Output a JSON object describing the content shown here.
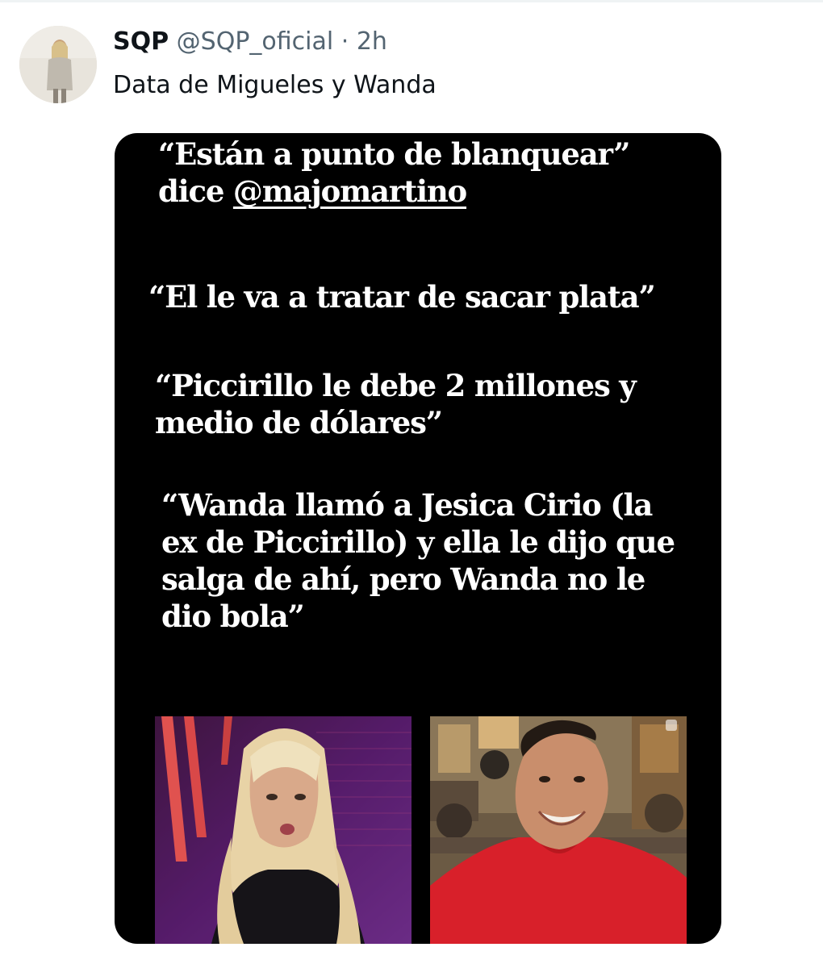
{
  "tweet": {
    "author_name": "SQP",
    "handle": "@SQP_oficial",
    "separator": "·",
    "time": "2h",
    "text": "Data de Migueles y Wanda"
  },
  "media": {
    "quote1_prefix": "“Están a punto de blanquear”",
    "quote1_dice": "dice ",
    "quote1_mention": "@majomartino",
    "quote2": "“El le va a tratar de sacar plata”",
    "quote3_lines": [
      "“Piccirillo le debe 2 millones y",
      "medio de dólares”"
    ],
    "quote4_lines": [
      "“Wanda llamó a Jesica Cirio (la",
      "ex de Piccirillo) y ella le dijo que",
      "salga de ahí, pero Wanda no le",
      "dio bola”"
    ]
  },
  "icons": {
    "avatar": "profile-photo",
    "left_photo": "woman-blonde-tv-studio-photo",
    "right_photo": "smiling-man-red-shirt-photo"
  },
  "colors": {
    "text": "#0f1419",
    "muted": "#536471",
    "media_bg": "#000000",
    "quote_text": "#ffffff"
  }
}
